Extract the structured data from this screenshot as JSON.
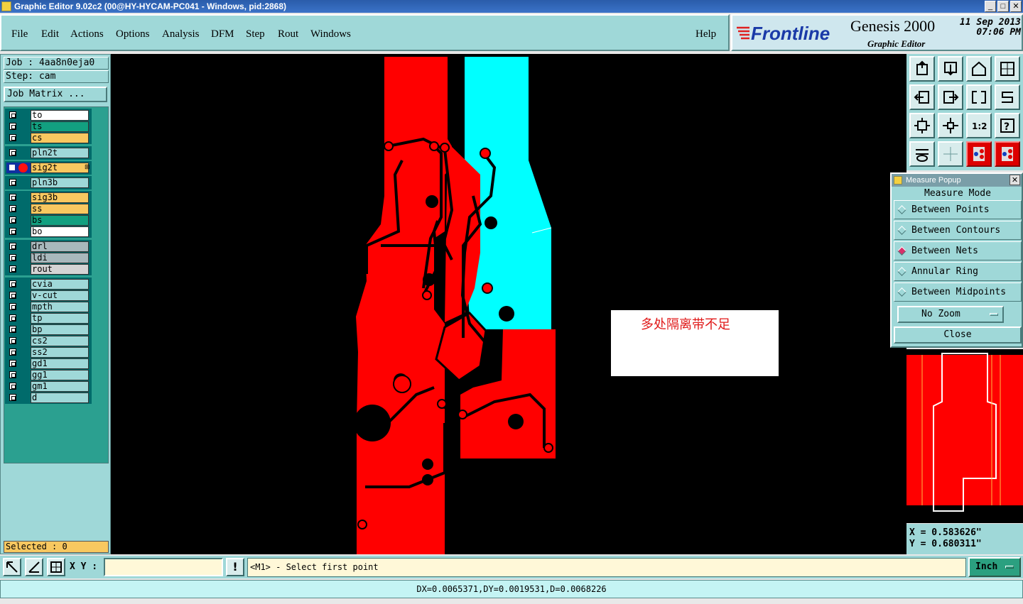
{
  "window": {
    "title": "Graphic Editor 9.02c2 (00@HY-HYCAM-PC041 - Windows, pid:2868)",
    "minimize": "_",
    "maximize": "□",
    "close": "✕"
  },
  "menu": {
    "items": [
      "File",
      "Edit",
      "Actions",
      "Options",
      "Analysis",
      "DFM",
      "Step",
      "Rout",
      "Windows"
    ],
    "help": "Help"
  },
  "logo": {
    "brand": "Frontline",
    "product": "Genesis 2000",
    "subtitle": "Graphic Editor",
    "date": "11 Sep 2013",
    "time": "07:06 PM"
  },
  "job": {
    "job_label": "Job : 4aa8n0eja0",
    "step_label": "Step: cam",
    "matrix_button": "Job Matrix ..."
  },
  "layers": {
    "group1": [
      {
        "name": "to",
        "color": "#ffffff"
      },
      {
        "name": "ts",
        "color": "#12a080"
      },
      {
        "name": "cs",
        "color": "#f8c860"
      }
    ],
    "group2": [
      {
        "name": "pln2t",
        "color": "#9fd8d8"
      }
    ],
    "group3": [
      {
        "name": "sig2t",
        "color": "#f8c860",
        "active": true
      }
    ],
    "group4": [
      {
        "name": "pln3b",
        "color": "#9fd8d8"
      }
    ],
    "group5": [
      {
        "name": "sig3b",
        "color": "#f8c860"
      },
      {
        "name": "ss",
        "color": "#f8c860"
      },
      {
        "name": "bs",
        "color": "#12a080"
      },
      {
        "name": "bo",
        "color": "#ffffff"
      }
    ],
    "group6": [
      {
        "name": "drl",
        "color": "#a8b8bc"
      },
      {
        "name": "ldi",
        "color": "#a8b8bc"
      },
      {
        "name": "rout",
        "color": "#d4d4d4"
      }
    ],
    "group7": [
      {
        "name": "cvia",
        "color": "#9fd8d8"
      },
      {
        "name": "v-cut",
        "color": "#9fd8d8"
      },
      {
        "name": "mpth",
        "color": "#9fd8d8"
      },
      {
        "name": "tp",
        "color": "#9fd8d8"
      },
      {
        "name": "bp",
        "color": "#9fd8d8"
      },
      {
        "name": "cs2",
        "color": "#9fd8d8"
      },
      {
        "name": "ss2",
        "color": "#9fd8d8"
      },
      {
        "name": "gd1",
        "color": "#9fd8d8"
      },
      {
        "name": "gg1",
        "color": "#9fd8d8"
      },
      {
        "name": "gm1",
        "color": "#9fd8d8"
      },
      {
        "name": "d",
        "color": "#9fd8d8"
      }
    ]
  },
  "selected": "Selected : 0",
  "canvas": {
    "note": "多处隔离带不足"
  },
  "measure": {
    "title": "Measure Popup",
    "heading": "Measure Mode",
    "options": [
      "Between Points",
      "Between Contours",
      "Between Nets",
      "Annular Ring",
      "Between Midpoints"
    ],
    "selected_option": "Between Nets",
    "zoom": "No Zoom",
    "close": "Close"
  },
  "coords": {
    "x": "X = 0.583626\"",
    "y": "Y = 0.680311\""
  },
  "bottom": {
    "xy_label": "X Y :",
    "xy_value": "",
    "warn": "!",
    "prompt": "<M1> - Select first point",
    "unit": "Inch"
  },
  "status": "DX=0.0065371,DY=0.0019531,D=0.0068226",
  "colors": {
    "panel": "#9fd8d8",
    "signal_layer": "#ff0000",
    "plane_layer": "#00ffff",
    "canvas_bg": "#000000"
  }
}
